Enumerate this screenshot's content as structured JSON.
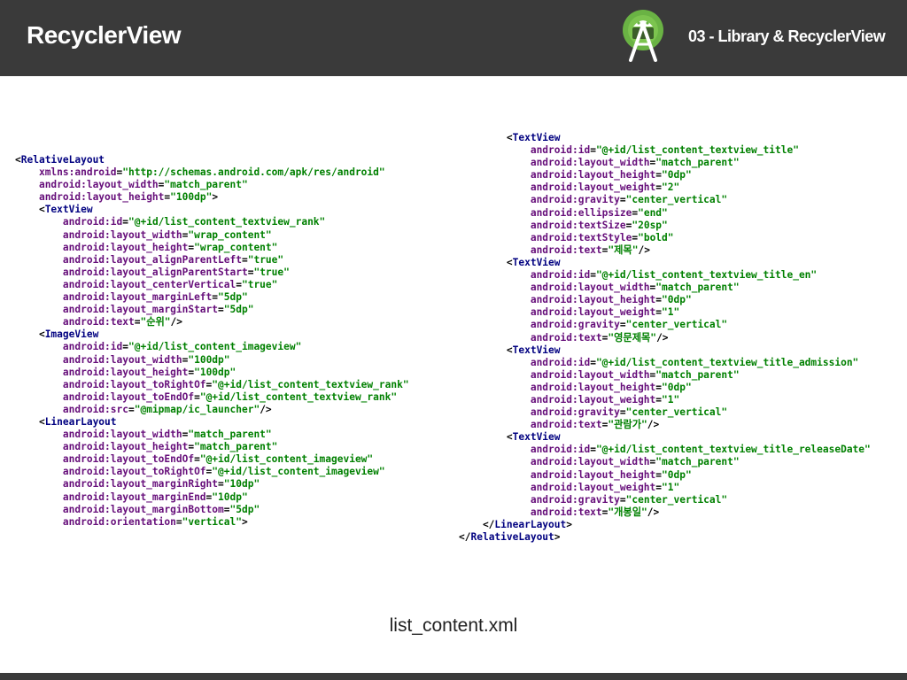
{
  "header": {
    "title": "RecyclerView",
    "subtitle": "03 - Library & RecyclerView",
    "logo_icon": "android-studio-icon",
    "background": "#3a3a3a"
  },
  "caption": "list_content.xml",
  "code_columns": [
    {
      "lines": [
        [
          [
            "p",
            "<"
          ],
          [
            "t",
            "RelativeLayout"
          ]
        ],
        [
          [
            "p",
            "    "
          ],
          [
            "a",
            "xmlns:android"
          ],
          [
            "p",
            "="
          ],
          [
            "v",
            "\"http://schemas.android.com/apk/res/android\""
          ]
        ],
        [
          [
            "p",
            "    "
          ],
          [
            "a",
            "android:layout_width"
          ],
          [
            "p",
            "="
          ],
          [
            "v",
            "\"match_parent\""
          ]
        ],
        [
          [
            "p",
            "    "
          ],
          [
            "a",
            "android:layout_height"
          ],
          [
            "p",
            "="
          ],
          [
            "v",
            "\"100dp\""
          ],
          [
            "p",
            ">"
          ]
        ],
        [
          [
            "p",
            "    <"
          ],
          [
            "t",
            "TextView"
          ]
        ],
        [
          [
            "p",
            "        "
          ],
          [
            "a",
            "android:id"
          ],
          [
            "p",
            "="
          ],
          [
            "v",
            "\"@+id/list_content_textview_rank\""
          ]
        ],
        [
          [
            "p",
            "        "
          ],
          [
            "a",
            "android:layout_width"
          ],
          [
            "p",
            "="
          ],
          [
            "v",
            "\"wrap_content\""
          ]
        ],
        [
          [
            "p",
            "        "
          ],
          [
            "a",
            "android:layout_height"
          ],
          [
            "p",
            "="
          ],
          [
            "v",
            "\"wrap_content\""
          ]
        ],
        [
          [
            "p",
            "        "
          ],
          [
            "a",
            "android:layout_alignParentLeft"
          ],
          [
            "p",
            "="
          ],
          [
            "v",
            "\"true\""
          ]
        ],
        [
          [
            "p",
            "        "
          ],
          [
            "a",
            "android:layout_alignParentStart"
          ],
          [
            "p",
            "="
          ],
          [
            "v",
            "\"true\""
          ]
        ],
        [
          [
            "p",
            "        "
          ],
          [
            "a",
            "android:layout_centerVertical"
          ],
          [
            "p",
            "="
          ],
          [
            "v",
            "\"true\""
          ]
        ],
        [
          [
            "p",
            "        "
          ],
          [
            "a",
            "android:layout_marginLeft"
          ],
          [
            "p",
            "="
          ],
          [
            "v",
            "\"5dp\""
          ]
        ],
        [
          [
            "p",
            "        "
          ],
          [
            "a",
            "android:layout_marginStart"
          ],
          [
            "p",
            "="
          ],
          [
            "v",
            "\"5dp\""
          ]
        ],
        [
          [
            "p",
            "        "
          ],
          [
            "a",
            "android:text"
          ],
          [
            "p",
            "="
          ],
          [
            "v",
            "\"순위\""
          ],
          [
            "p",
            "/>"
          ]
        ],
        [
          [
            "p",
            "    <"
          ],
          [
            "t",
            "ImageView"
          ]
        ],
        [
          [
            "p",
            "        "
          ],
          [
            "a",
            "android:id"
          ],
          [
            "p",
            "="
          ],
          [
            "v",
            "\"@+id/list_content_imageview\""
          ]
        ],
        [
          [
            "p",
            "        "
          ],
          [
            "a",
            "android:layout_width"
          ],
          [
            "p",
            "="
          ],
          [
            "v",
            "\"100dp\""
          ]
        ],
        [
          [
            "p",
            "        "
          ],
          [
            "a",
            "android:layout_height"
          ],
          [
            "p",
            "="
          ],
          [
            "v",
            "\"100dp\""
          ]
        ],
        [
          [
            "p",
            "        "
          ],
          [
            "a",
            "android:layout_toRightOf"
          ],
          [
            "p",
            "="
          ],
          [
            "v",
            "\"@+id/list_content_textview_rank\""
          ]
        ],
        [
          [
            "p",
            "        "
          ],
          [
            "a",
            "android:layout_toEndOf"
          ],
          [
            "p",
            "="
          ],
          [
            "v",
            "\"@+id/list_content_textview_rank\""
          ]
        ],
        [
          [
            "p",
            "        "
          ],
          [
            "a",
            "android:src"
          ],
          [
            "p",
            "="
          ],
          [
            "v",
            "\"@mipmap/ic_launcher\""
          ],
          [
            "p",
            "/>"
          ]
        ],
        [
          [
            "p",
            "    <"
          ],
          [
            "t",
            "LinearLayout"
          ]
        ],
        [
          [
            "p",
            "        "
          ],
          [
            "a",
            "android:layout_width"
          ],
          [
            "p",
            "="
          ],
          [
            "v",
            "\"match_parent\""
          ]
        ],
        [
          [
            "p",
            "        "
          ],
          [
            "a",
            "android:layout_height"
          ],
          [
            "p",
            "="
          ],
          [
            "v",
            "\"match_parent\""
          ]
        ],
        [
          [
            "p",
            "        "
          ],
          [
            "a",
            "android:layout_toEndOf"
          ],
          [
            "p",
            "="
          ],
          [
            "v",
            "\"@+id/list_content_imageview\""
          ]
        ],
        [
          [
            "p",
            "        "
          ],
          [
            "a",
            "android:layout_toRightOf"
          ],
          [
            "p",
            "="
          ],
          [
            "v",
            "\"@+id/list_content_imageview\""
          ]
        ],
        [
          [
            "p",
            "        "
          ],
          [
            "a",
            "android:layout_marginRight"
          ],
          [
            "p",
            "="
          ],
          [
            "v",
            "\"10dp\""
          ]
        ],
        [
          [
            "p",
            "        "
          ],
          [
            "a",
            "android:layout_marginEnd"
          ],
          [
            "p",
            "="
          ],
          [
            "v",
            "\"10dp\""
          ]
        ],
        [
          [
            "p",
            "        "
          ],
          [
            "a",
            "android:layout_marginBottom"
          ],
          [
            "p",
            "="
          ],
          [
            "v",
            "\"5dp\""
          ]
        ],
        [
          [
            "p",
            "        "
          ],
          [
            "a",
            "android:orientation"
          ],
          [
            "p",
            "="
          ],
          [
            "v",
            "\"vertical\""
          ],
          [
            "p",
            ">"
          ]
        ]
      ]
    },
    {
      "lines": [
        [
          [
            "p",
            "        <"
          ],
          [
            "t",
            "TextView"
          ]
        ],
        [
          [
            "p",
            "            "
          ],
          [
            "a",
            "android:id"
          ],
          [
            "p",
            "="
          ],
          [
            "v",
            "\"@+id/list_content_textview_title\""
          ]
        ],
        [
          [
            "p",
            "            "
          ],
          [
            "a",
            "android:layout_width"
          ],
          [
            "p",
            "="
          ],
          [
            "v",
            "\"match_parent\""
          ]
        ],
        [
          [
            "p",
            "            "
          ],
          [
            "a",
            "android:layout_height"
          ],
          [
            "p",
            "="
          ],
          [
            "v",
            "\"0dp\""
          ]
        ],
        [
          [
            "p",
            "            "
          ],
          [
            "a",
            "android:layout_weight"
          ],
          [
            "p",
            "="
          ],
          [
            "v",
            "\"2\""
          ]
        ],
        [
          [
            "p",
            "            "
          ],
          [
            "a",
            "android:gravity"
          ],
          [
            "p",
            "="
          ],
          [
            "v",
            "\"center_vertical\""
          ]
        ],
        [
          [
            "p",
            "            "
          ],
          [
            "a",
            "android:ellipsize"
          ],
          [
            "p",
            "="
          ],
          [
            "v",
            "\"end\""
          ]
        ],
        [
          [
            "p",
            "            "
          ],
          [
            "a",
            "android:textSize"
          ],
          [
            "p",
            "="
          ],
          [
            "v",
            "\"20sp\""
          ]
        ],
        [
          [
            "p",
            "            "
          ],
          [
            "a",
            "android:textStyle"
          ],
          [
            "p",
            "="
          ],
          [
            "v",
            "\"bold\""
          ]
        ],
        [
          [
            "p",
            "            "
          ],
          [
            "a",
            "android:text"
          ],
          [
            "p",
            "="
          ],
          [
            "v",
            "\"제목\""
          ],
          [
            "p",
            "/>"
          ]
        ],
        [
          [
            "p",
            "        <"
          ],
          [
            "t",
            "TextView"
          ]
        ],
        [
          [
            "p",
            "            "
          ],
          [
            "a",
            "android:id"
          ],
          [
            "p",
            "="
          ],
          [
            "v",
            "\"@+id/list_content_textview_title_en\""
          ]
        ],
        [
          [
            "p",
            "            "
          ],
          [
            "a",
            "android:layout_width"
          ],
          [
            "p",
            "="
          ],
          [
            "v",
            "\"match_parent\""
          ]
        ],
        [
          [
            "p",
            "            "
          ],
          [
            "a",
            "android:layout_height"
          ],
          [
            "p",
            "="
          ],
          [
            "v",
            "\"0dp\""
          ]
        ],
        [
          [
            "p",
            "            "
          ],
          [
            "a",
            "android:layout_weight"
          ],
          [
            "p",
            "="
          ],
          [
            "v",
            "\"1\""
          ]
        ],
        [
          [
            "p",
            "            "
          ],
          [
            "a",
            "android:gravity"
          ],
          [
            "p",
            "="
          ],
          [
            "v",
            "\"center_vertical\""
          ]
        ],
        [
          [
            "p",
            "            "
          ],
          [
            "a",
            "android:text"
          ],
          [
            "p",
            "="
          ],
          [
            "v",
            "\"영문제목\""
          ],
          [
            "p",
            "/>"
          ]
        ],
        [
          [
            "p",
            "        <"
          ],
          [
            "t",
            "TextView"
          ]
        ],
        [
          [
            "p",
            "            "
          ],
          [
            "a",
            "android:id"
          ],
          [
            "p",
            "="
          ],
          [
            "v",
            "\"@+id/list_content_textview_title_admission\""
          ]
        ],
        [
          [
            "p",
            "            "
          ],
          [
            "a",
            "android:layout_width"
          ],
          [
            "p",
            "="
          ],
          [
            "v",
            "\"match_parent\""
          ]
        ],
        [
          [
            "p",
            "            "
          ],
          [
            "a",
            "android:layout_height"
          ],
          [
            "p",
            "="
          ],
          [
            "v",
            "\"0dp\""
          ]
        ],
        [
          [
            "p",
            "            "
          ],
          [
            "a",
            "android:layout_weight"
          ],
          [
            "p",
            "="
          ],
          [
            "v",
            "\"1\""
          ]
        ],
        [
          [
            "p",
            "            "
          ],
          [
            "a",
            "android:gravity"
          ],
          [
            "p",
            "="
          ],
          [
            "v",
            "\"center_vertical\""
          ]
        ],
        [
          [
            "p",
            "            "
          ],
          [
            "a",
            "android:text"
          ],
          [
            "p",
            "="
          ],
          [
            "v",
            "\"관람가\""
          ],
          [
            "p",
            "/>"
          ]
        ],
        [
          [
            "p",
            "        <"
          ],
          [
            "t",
            "TextView"
          ]
        ],
        [
          [
            "p",
            "            "
          ],
          [
            "a",
            "android:id"
          ],
          [
            "p",
            "="
          ],
          [
            "v",
            "\"@+id/list_content_textview_title_releaseDate\""
          ]
        ],
        [
          [
            "p",
            "            "
          ],
          [
            "a",
            "android:layout_width"
          ],
          [
            "p",
            "="
          ],
          [
            "v",
            "\"match_parent\""
          ]
        ],
        [
          [
            "p",
            "            "
          ],
          [
            "a",
            "android:layout_height"
          ],
          [
            "p",
            "="
          ],
          [
            "v",
            "\"0dp\""
          ]
        ],
        [
          [
            "p",
            "            "
          ],
          [
            "a",
            "android:layout_weight"
          ],
          [
            "p",
            "="
          ],
          [
            "v",
            "\"1\""
          ]
        ],
        [
          [
            "p",
            "            "
          ],
          [
            "a",
            "android:gravity"
          ],
          [
            "p",
            "="
          ],
          [
            "v",
            "\"center_vertical\""
          ]
        ],
        [
          [
            "p",
            "            "
          ],
          [
            "a",
            "android:text"
          ],
          [
            "p",
            "="
          ],
          [
            "v",
            "\"개봉일\""
          ],
          [
            "p",
            "/>"
          ]
        ],
        [
          [
            "p",
            "    </"
          ],
          [
            "t",
            "LinearLayout"
          ],
          [
            "p",
            ">"
          ]
        ],
        [
          [
            "p",
            "</"
          ],
          [
            "t",
            "RelativeLayout"
          ],
          [
            "p",
            ">"
          ]
        ]
      ]
    }
  ]
}
